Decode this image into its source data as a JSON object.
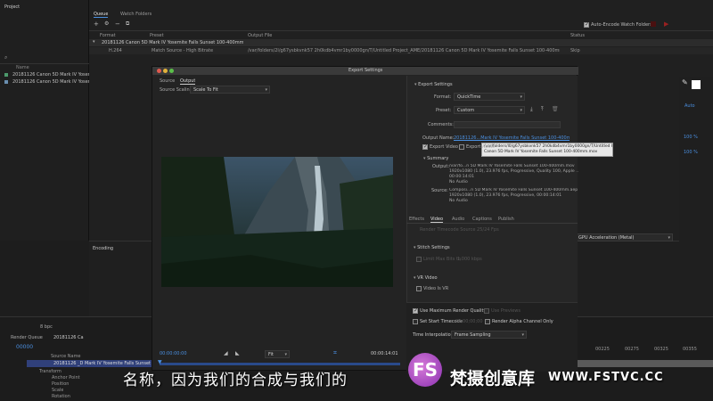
{
  "project": {
    "title": "Project",
    "search_icon": "search-icon",
    "col_name": "Name",
    "items": [
      "20181126 Canon 5D Mark IV Yosemite",
      "20181126 Canon 5D Mark IV Yosemite"
    ]
  },
  "queue": {
    "tabs": [
      "Queue",
      "Watch Folders"
    ],
    "auto_encode": "Auto-Encode Watch Folders",
    "headers": {
      "format": "Format",
      "preset": "Preset",
      "output": "Output File",
      "status": "Status"
    },
    "group": "20181126 Canon 5D Mark IV Yosemite Falls Sunset 100-400mm",
    "row": {
      "format": "H.264",
      "preset": "Match Source - High Bitrate",
      "output": "/var/folders/2l/g67ysbkvnk57 2h0kdb4vmr1by0000gn/T/Untitled Project_AME/20181126 Canon 5D Mark IV Yosemite Falls Sunset 100-400mm_1.mp4",
      "status": "Skip"
    }
  },
  "encoding": {
    "title": "Encoding",
    "gpu": "GPU Acceleration (Metal)"
  },
  "export_dialog": {
    "title": "Export Settings",
    "tabs": [
      "Source",
      "Output"
    ],
    "source_scaling_label": "Source Scaling:",
    "source_scaling_value": "Scale To Fit",
    "export_settings_header": "Export Settings",
    "format_label": "Format:",
    "format_value": "QuickTime",
    "preset_label": "Preset:",
    "preset_value": "Custom",
    "comments_label": "Comments:",
    "output_name_label": "Output Name:",
    "output_name_value": "20181126...Mark IV Yosemite Falls Sunset 100-400mm.mov",
    "tooltip_line1": "/var/folders/l0/g67ysbkvnk57 2h0kdb4vmr1by0000gn/T/Untitled Project_AME/20181126",
    "tooltip_line2": "Canon 5D Mark IV Yosemite Falls Sunset 100-400mm.mov",
    "export_video": "Export Video",
    "export_audio": "Export Audio",
    "summary_header": "Summary",
    "output_label": "Output:",
    "output_lines": [
      "/var/fo...n 5D Mark IV Yosemite Falls Sunset 100-400mm.mov",
      "1920x1080 (1.0), 23.976 fps, Progressive, Quality 100, Apple ...",
      "00:00:14:01",
      "No Audio"
    ],
    "source_label": "Source:",
    "source_lines": [
      "Composi...n 5D Mark IV Yosemite Falls Sunset 100-400mm.aep",
      "1920x1080 (1.0), 23.976 fps, Progressive, 00:00:14:01",
      "No Audio"
    ],
    "bottom_tabs": [
      "Effects",
      "Video",
      "Audio",
      "Captions",
      "Publish"
    ],
    "render_time": "Render Timecode Source 25/24 Fps",
    "stitch": "Stitch Settings",
    "limit_bits": "Limit Max Bits to",
    "limit_value": "1,000 kbps",
    "vr_header": "VR Video",
    "video_vr": "Video Is VR",
    "max_quality": "Use Maximum Render Quality",
    "use_previews": "Use Previews",
    "start_tc": "Set Start Timecode",
    "start_tc_value": "00;00;00;00",
    "alpha": "Render Alpha Channel Only",
    "interp_label": "Time Interpolation:",
    "interp_value": "Frame Sampling",
    "tc_start": "00:00:00:00",
    "tc_end": "00:00:14:01",
    "fit": "Fit"
  },
  "timeline": {
    "render_queue": "Render Queue",
    "comp_tab": "20181126 Ca",
    "timecode": "00000",
    "layer_name": "20181126 _D Mark IV Yosemite Falls Sunset 100-4",
    "props": [
      "Transform",
      "Anchor Point",
      "Position",
      "Scale",
      "Rotation"
    ],
    "src_name": "Source Name",
    "ruler": [
      "00225",
      "00275",
      "00325",
      "00355"
    ],
    "bpc": "8 bpc"
  },
  "right_panel": {
    "auto": "Auto",
    "pct1": "100 %",
    "pct2": "100 %"
  },
  "subtitle": "名称，因为我们的合成与我们的",
  "watermark": {
    "logo": "FS",
    "name": "梵摄创意库",
    "url": "WWW.FSTVC.CC"
  },
  "colors": {
    "accent": "#4a8fe0",
    "bg": "#1d1d1d",
    "dialog": "#232323"
  }
}
